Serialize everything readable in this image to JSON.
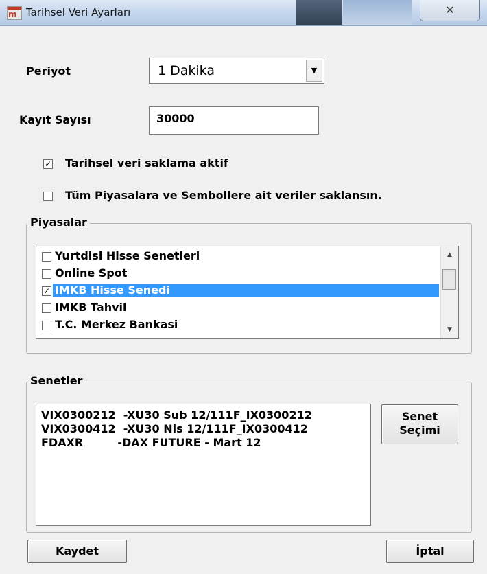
{
  "window": {
    "title": "Tarihsel Veri Ayarları",
    "close_glyph": "✕"
  },
  "form": {
    "periyot_label": "Periyot",
    "periyot_value": "1 Dakika",
    "kayit_label": "Kayıt Sayısı",
    "kayit_value": "30000",
    "check_aktif_label": "Tarihsel veri saklama aktif",
    "check_aktif_checked": true,
    "check_tum_label": "Tüm Piyasalara ve Sembollere ait veriler saklansın.",
    "check_tum_checked": false
  },
  "piyasalar": {
    "title": "Piyasalar",
    "items": [
      {
        "label": "Yurtdisi Hisse Senetleri",
        "checked": false,
        "selected": false
      },
      {
        "label": "Online Spot",
        "checked": false,
        "selected": false
      },
      {
        "label": "IMKB Hisse Senedi",
        "checked": true,
        "selected": true
      },
      {
        "label": "IMKB Tahvil",
        "checked": false,
        "selected": false
      },
      {
        "label": "T.C. Merkez Bankasi",
        "checked": false,
        "selected": false
      }
    ]
  },
  "senetler": {
    "title": "Senetler",
    "rows": [
      "VIX0300212  -XU30 Sub 12/111F_IX0300212",
      "VIX0300412  -XU30 Nis 12/111F_IX0300412",
      "FDAXR         -DAX FUTURE - Mart 12"
    ],
    "select_button_line1": "Senet",
    "select_button_line2": "Seçimi"
  },
  "footer": {
    "save_label": "Kaydet",
    "cancel_label": "İptal"
  }
}
